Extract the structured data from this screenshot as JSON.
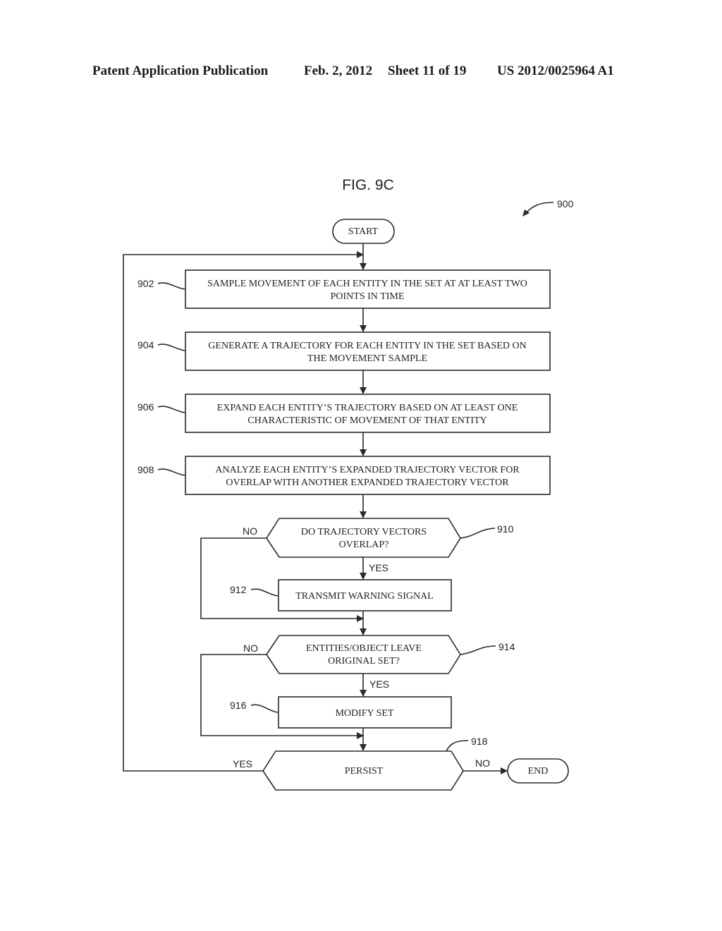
{
  "header": {
    "publication": "Patent Application Publication",
    "date": "Feb. 2, 2012",
    "sheet": "Sheet 11 of 19",
    "number": "US 2012/0025964 A1"
  },
  "figure": {
    "title": "FIG. 9C",
    "ref": "900"
  },
  "nodes": {
    "start": {
      "text": "START"
    },
    "n902": {
      "ref": "902",
      "line1": "SAMPLE MOVEMENT OF EACH ENTITY IN THE SET AT AT LEAST TWO",
      "line2": "POINTS IN TIME"
    },
    "n904": {
      "ref": "904",
      "line1": "GENERATE A TRAJECTORY FOR EACH ENTITY IN THE SET BASED ON",
      "line2": "THE MOVEMENT SAMPLE"
    },
    "n906": {
      "ref": "906",
      "line1": "EXPAND EACH ENTITY’S TRAJECTORY BASED ON AT LEAST ONE",
      "line2": "CHARACTERISTIC OF MOVEMENT OF THAT ENTITY"
    },
    "n908": {
      "ref": "908",
      "line1": "ANALYZE EACH ENTITY’S EXPANDED TRAJECTORY VECTOR FOR",
      "line2": "OVERLAP WITH ANOTHER EXPANDED TRAJECTORY VECTOR"
    },
    "n910": {
      "ref": "910",
      "line1": "DO TRAJECTORY VECTORS",
      "line2": "OVERLAP?",
      "no": "NO",
      "yes": "YES"
    },
    "n912": {
      "ref": "912",
      "text": "TRANSMIT WARNING SIGNAL"
    },
    "n914": {
      "ref": "914",
      "line1": "ENTITIES/OBJECT LEAVE",
      "line2": "ORIGINAL SET?",
      "no": "NO",
      "yes": "YES"
    },
    "n916": {
      "ref": "916",
      "text": "MODIFY SET"
    },
    "n918": {
      "ref": "918",
      "text": "PERSIST",
      "yes": "YES",
      "no": "NO"
    },
    "end": {
      "text": "END"
    }
  }
}
